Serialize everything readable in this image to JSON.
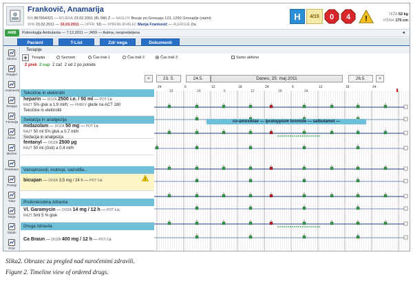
{
  "header": {
    "patient_name": "Frankovič, Anamarija",
    "bis_label": "BIS",
    "bis_value": "867654321",
    "born_label": "ROJENA",
    "born_value": "23.02.2001 (8L 5M) Ž",
    "address_label": "NASLOV",
    "address_value": "Brezje pri Grosupju 123, 1290 Grosuplje (stalni)",
    "spr_label": "SPR",
    "spr_value": "23.02.2011",
    "ops_date": "10.03.2011",
    "oper_label": "OPER.",
    "oper_value": "5D",
    "companion_label": "SPREMLJEVALEC",
    "companion_value": "Marija Frankovič",
    "allergy_label": "ALERGIJE",
    "allergy_value": "Da",
    "indicator_h": "H",
    "indicator_count": "4/15",
    "indicator_zero": "0",
    "indicator_four": "4",
    "weight_label": "TEŽA",
    "weight_value": "52 kg",
    "height_label": "VIŠINA",
    "height_value": "175 cm"
  },
  "dxbar": {
    "badge": "AMB",
    "text": "Pulmologija Ambulanta — 7.12.2011 — J459 — Astma, neopredeljena",
    "arrow": "◄"
  },
  "tabs": [
    "Pacient",
    "T-List",
    "Zdr nega",
    "Dokumenti"
  ],
  "iconbar": [
    {
      "label": "Skorno",
      "icon": "chart-icon"
    },
    {
      "label": "Pregled",
      "icon": "stethoscope-icon"
    },
    {
      "label": "Anamneza",
      "icon": "notes-icon"
    },
    {
      "label": "Terapija",
      "icon": "pill-icon"
    },
    {
      "label": "T-krivulja",
      "icon": "curve-icon"
    },
    {
      "label": "Zdrav.",
      "icon": "documents-icon"
    },
    {
      "label": "Meritve",
      "icon": "gauge-icon"
    },
    {
      "label": "Preiskave",
      "icon": "flask-icon"
    },
    {
      "label": "Posegi",
      "icon": "syringe-icon"
    },
    {
      "label": "Tuba",
      "icon": "tube-icon"
    },
    {
      "label": "Nega",
      "icon": "care-icon"
    },
    {
      "label": "Ostalo",
      "icon": "gear-icon"
    },
    {
      "label": "Print",
      "icon": "print-icon"
    }
  ],
  "main": {
    "section_title": "Terapije",
    "add_label": "Terapija",
    "filters": [
      "Seznam",
      "Čas trak 1",
      "Čas trak 2",
      "Čas trak 3"
    ],
    "active_filter": 3,
    "checkbox_label": "Samo aktivne",
    "count_pre": "2 prek",
    "count_nap": "2 nap",
    "count_zac": "2 zač",
    "count_od": "2 od 2 po potrebi"
  },
  "datenav": {
    "prev": "<",
    "d1": "23. 5.",
    "d2": "24.5.",
    "today": "Danes, 25. maj 2011",
    "d4": "26.5.",
    "next": ">",
    "ticks_top": [
      "24",
      "6",
      "12",
      "18",
      "24",
      "6",
      "12",
      "18",
      "24"
    ],
    "ticks_sub": [
      "18",
      "24",
      "6",
      "12",
      "18",
      "24"
    ],
    "banner": "co-amoxiklav — ipratoppium bromide — salbutamol —"
  },
  "categories": [
    {
      "name": "Tekočine in elektroliti"
    },
    {
      "name": "Sedacija in analgezija"
    },
    {
      "name": "Vazoprosorji, inotropi, vazodila..."
    },
    {
      "name": "Protimikrobna zdravila"
    },
    {
      "name": "Druga zdravila"
    }
  ],
  "drugs": [
    {
      "name": "heparin",
      "dose_label": "DOZA",
      "dose": "2500 i.e. / 50 ml",
      "route_label": "POT",
      "route": "i.v.",
      "line2": "5% gluk a 1,9 ml/h;",
      "freq": "glede na ACT 180",
      "line3": "Tekočine in elektroliti"
    },
    {
      "name": "midazolam",
      "dose_label": "DOZA",
      "dose": "50 mg",
      "route_label": "POT",
      "route": "i.v.",
      "line2": "50 ml 5% gluk a 0,7 ml/h",
      "line3": "Sedacija in analgezija"
    },
    {
      "name": "fentanyl",
      "dose_label": "DOZA",
      "dose": "2500 µg",
      "route_label": "POT",
      "route": "i.v.",
      "line2": "50 ml (čisti) a 0,4 ml/h"
    },
    {
      "name": "bicupan",
      "dose_label": "DOZA",
      "dose": "3,5 mg / 24 h",
      "route_label": "POT",
      "route": "i.v."
    },
    {
      "name": "Vl. Garamycin",
      "dose_label": "DOZA",
      "dose": "14 mg / 12 h",
      "route_label": "POT",
      "route": "i.v.",
      "line2": "5ml 5 % gluk"
    },
    {
      "name": "Ca Braun",
      "dose_label": "DOZA",
      "dose": "400 mg / 12 h",
      "route_label": "POT",
      "route": "i.v."
    }
  ],
  "captions": {
    "sl": "Slika2. Obrazec za pregled nad naročenimi zdravili.",
    "en": "Figure 2. Timeline view of ordered drugs."
  },
  "colors": {
    "tab_blue": "#2a6fc6",
    "category_teal": "#6fbfd8",
    "marker_green": "#2e9e44",
    "marker_red": "#c0141a",
    "row_line": "#1b3e8a"
  }
}
